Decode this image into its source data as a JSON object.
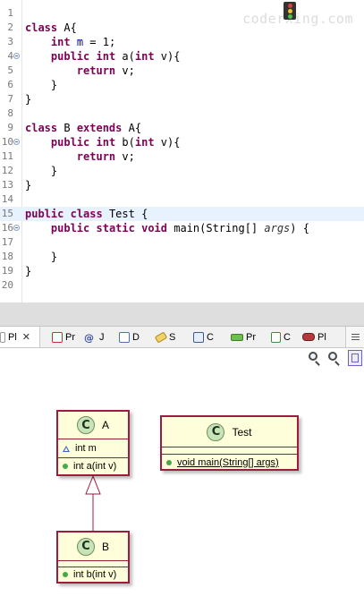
{
  "editor": {
    "watermark": "coderxing.com",
    "lines": [
      {
        "num": "1"
      },
      {
        "num": "2",
        "text": "class A{"
      },
      {
        "num": "3",
        "text": "    int m = 1;"
      },
      {
        "num": "4",
        "text": "    public int a(int v){"
      },
      {
        "num": "5",
        "text": "        return v;"
      },
      {
        "num": "6",
        "text": "    }"
      },
      {
        "num": "7",
        "text": "}"
      },
      {
        "num": "8"
      },
      {
        "num": "9",
        "text": "class B extends A{"
      },
      {
        "num": "10",
        "text": "    public int b(int v){"
      },
      {
        "num": "11",
        "text": "        return v;"
      },
      {
        "num": "12",
        "text": "    }"
      },
      {
        "num": "13",
        "text": "}"
      },
      {
        "num": "14"
      },
      {
        "num": "15",
        "text": "public class Test {"
      },
      {
        "num": "16",
        "text": "    public static void main(String[] args) {"
      },
      {
        "num": "17"
      },
      {
        "num": "18",
        "text": "    }"
      },
      {
        "num": "19",
        "text": "}"
      },
      {
        "num": "20"
      }
    ]
  },
  "view_tabs": [
    {
      "label": "Pl",
      "icon": "plantuml-view-icon",
      "active": true
    },
    {
      "label": "Pr",
      "icon": "problems-icon"
    },
    {
      "label": "J",
      "icon": "javadoc-icon"
    },
    {
      "label": "D",
      "icon": "declaration-icon"
    },
    {
      "label": "S",
      "icon": "search-view-icon"
    },
    {
      "label": "C",
      "icon": "console-icon"
    },
    {
      "label": "Pr",
      "icon": "progress-icon"
    },
    {
      "label": "C",
      "icon": "call-hierarchy-icon"
    },
    {
      "label": "Pl",
      "icon": "plugin-icon"
    }
  ],
  "toolbar": {
    "icons": [
      "traffic-light-icon",
      "zoom-in-icon",
      "zoom-out-icon",
      "fit-to-window-icon"
    ]
  },
  "diagram": {
    "class_a": {
      "icon_letter": "C",
      "name": "A",
      "field": "int m",
      "method": "int a(int v)"
    },
    "class_test": {
      "icon_letter": "C",
      "name": "Test",
      "method": "void main(String[] args)"
    },
    "class_b": {
      "icon_letter": "C",
      "name": "B",
      "method": "int b(int v)"
    },
    "relation": "B extends A"
  },
  "colors": {
    "keyword": "#7f0055",
    "field": "#0000c0",
    "current_line": "#e8f2fe",
    "uml_fill": "#fffeda",
    "uml_border": "#9b1c3e",
    "class_icon": "#c7e4b8",
    "public_dot": "#47a84a",
    "package_triangle": "#3b66c7"
  }
}
